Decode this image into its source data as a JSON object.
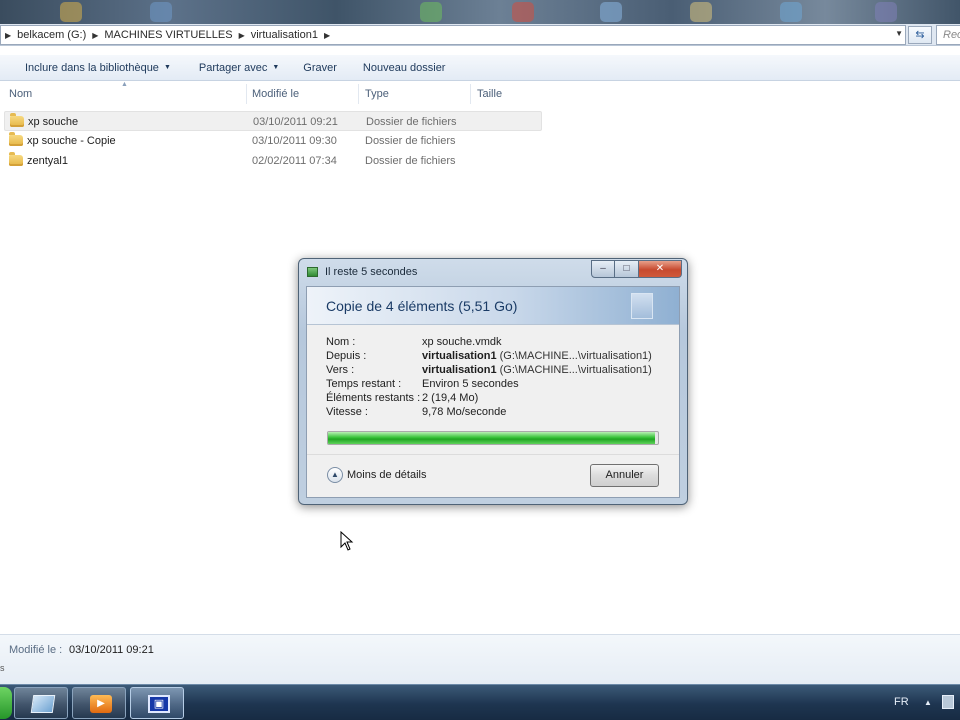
{
  "address_bar": {
    "segments": [
      "belkacem (G:)",
      "MACHINES VIRTUELLES",
      "virtualisation1"
    ],
    "search_placeholder": "Rec"
  },
  "toolbar": {
    "include_library": "Inclure dans la bibliothèque",
    "share_with": "Partager avec",
    "burn": "Graver",
    "new_folder": "Nouveau dossier"
  },
  "columns": {
    "name": "Nom",
    "modified": "Modifié le",
    "type": "Type",
    "size": "Taille"
  },
  "files": [
    {
      "name": "xp souche",
      "modified": "03/10/2011 09:21",
      "type": "Dossier de fichiers"
    },
    {
      "name": "xp souche - Copie",
      "modified": "03/10/2011 09:30",
      "type": "Dossier de fichiers"
    },
    {
      "name": "zentyal1",
      "modified": "02/02/2011 07:34",
      "type": "Dossier de fichiers"
    }
  ],
  "details": {
    "label": "Modifié le :",
    "value": "03/10/2011 09:21",
    "tiny": "s"
  },
  "dialog": {
    "title": "Il reste 5 secondes",
    "heading": "Copie de 4 éléments (5,51 Go)",
    "fields": {
      "name_label": "Nom :",
      "name_value": "xp souche.vmdk",
      "from_label": "Depuis :",
      "from_bold": "virtualisation1",
      "from_path": "(G:\\MACHINE...\\virtualisation1)",
      "to_label": "Vers :",
      "to_bold": "virtualisation1",
      "to_path": "(G:\\MACHINE...\\virtualisation1)",
      "time_label": "Temps restant :",
      "time_value": "Environ 5 secondes",
      "items_label": "Éléments restants :",
      "items_value": "2 (19,4 Mo)",
      "speed_label": "Vitesse :",
      "speed_value": "9,78 Mo/seconde"
    },
    "progress_fraction": 0.99,
    "less_details": "Moins de détails",
    "cancel": "Annuler"
  },
  "taskbar": {
    "language": "FR"
  },
  "icons": {
    "folder": "folder-icon",
    "explorer": "windows-explorer-icon",
    "media": "media-player-icon",
    "vm": "virtual-machine-icon"
  },
  "colors": {
    "progress_green": "#21a524",
    "taskbar": "#1e3550",
    "dialog_heading": "#1a3b66"
  }
}
